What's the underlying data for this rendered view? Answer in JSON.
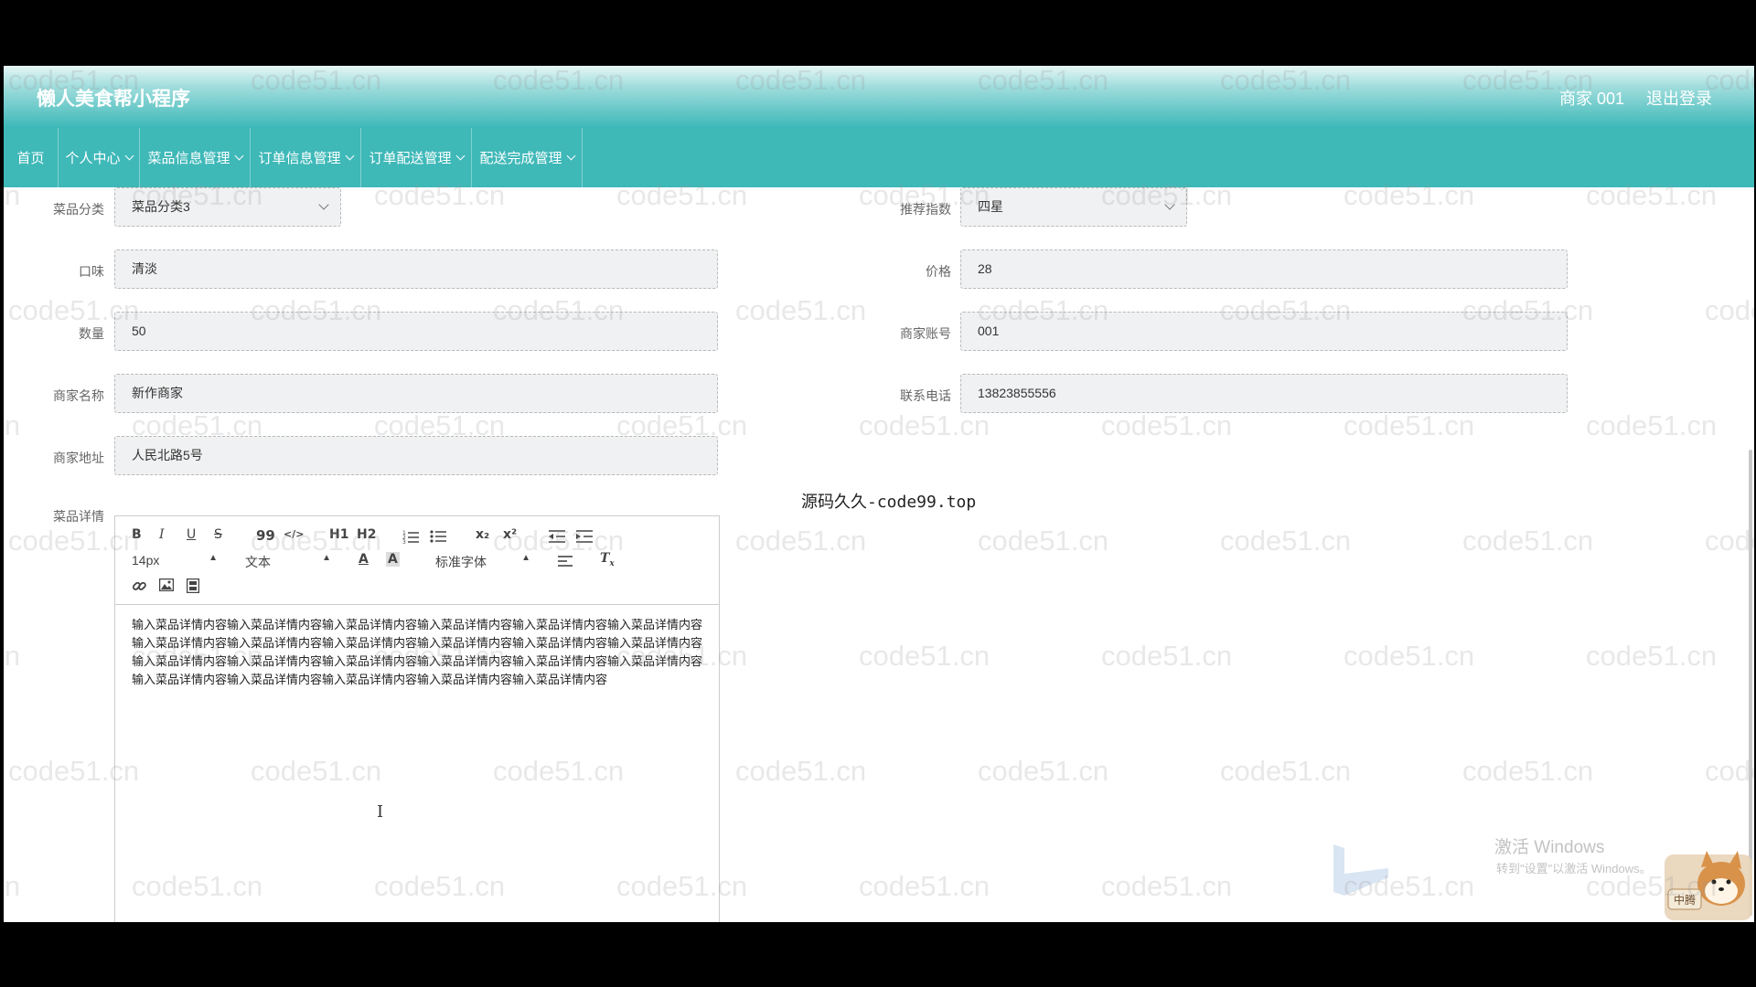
{
  "header": {
    "app_title": "懒人美食帮小程序",
    "user": "商家 001",
    "logout": "退出登录"
  },
  "nav": [
    {
      "label": "首页",
      "has_menu": false
    },
    {
      "label": "个人中心",
      "has_menu": true
    },
    {
      "label": "菜品信息管理",
      "has_menu": true
    },
    {
      "label": "订单信息管理",
      "has_menu": true
    },
    {
      "label": "订单配送管理",
      "has_menu": true
    },
    {
      "label": "配送完成管理",
      "has_menu": true
    }
  ],
  "form": {
    "category": {
      "label": "菜品分类",
      "value": "菜品分类3"
    },
    "rating": {
      "label": "推荐指数",
      "value": "四星"
    },
    "taste": {
      "label": "口味",
      "value": "清淡"
    },
    "price": {
      "label": "价格",
      "value": "28"
    },
    "quantity": {
      "label": "数量",
      "value": "50"
    },
    "merchant_account": {
      "label": "商家账号",
      "value": "001"
    },
    "merchant_name": {
      "label": "商家名称",
      "value": "新作商家"
    },
    "phone": {
      "label": "联系电话",
      "value": "13823855556"
    },
    "address": {
      "label": "商家地址",
      "value": "人民北路5号"
    },
    "details": {
      "label": "菜品详情"
    }
  },
  "editor": {
    "toolbar": {
      "bold": "B",
      "italic": "I",
      "underline": "U",
      "strike": "S",
      "quote": "99",
      "code": "</>",
      "h1": "H1",
      "h2": "H2",
      "sub": "x₂",
      "sup": "x²",
      "size": "14px",
      "format": "文本",
      "font": "标准字体"
    },
    "content": "输入菜品详情内容输入菜品详情内容输入菜品详情内容输入菜品详情内容输入菜品详情内容输入菜品详情内容输入菜品详情内容输入菜品详情内容输入菜品详情内容输入菜品详情内容输入菜品详情内容输入菜品详情内容输入菜品详情内容输入菜品详情内容输入菜品详情内容输入菜品详情内容输入菜品详情内容输入菜品详情内容输入菜品详情内容输入菜品详情内容输入菜品详情内容输入菜品详情内容输入菜品详情内容"
  },
  "watermark_text": "code51.cn",
  "promo_text": "源码久久-code99.top",
  "windows_activation": {
    "line1": "激活 Windows",
    "line2": "转到\"设置\"以激活 Windows。"
  },
  "dog_badge": "中腾",
  "colors": {
    "teal": "#3fb8b8",
    "field_bg": "#f0f1f2"
  }
}
